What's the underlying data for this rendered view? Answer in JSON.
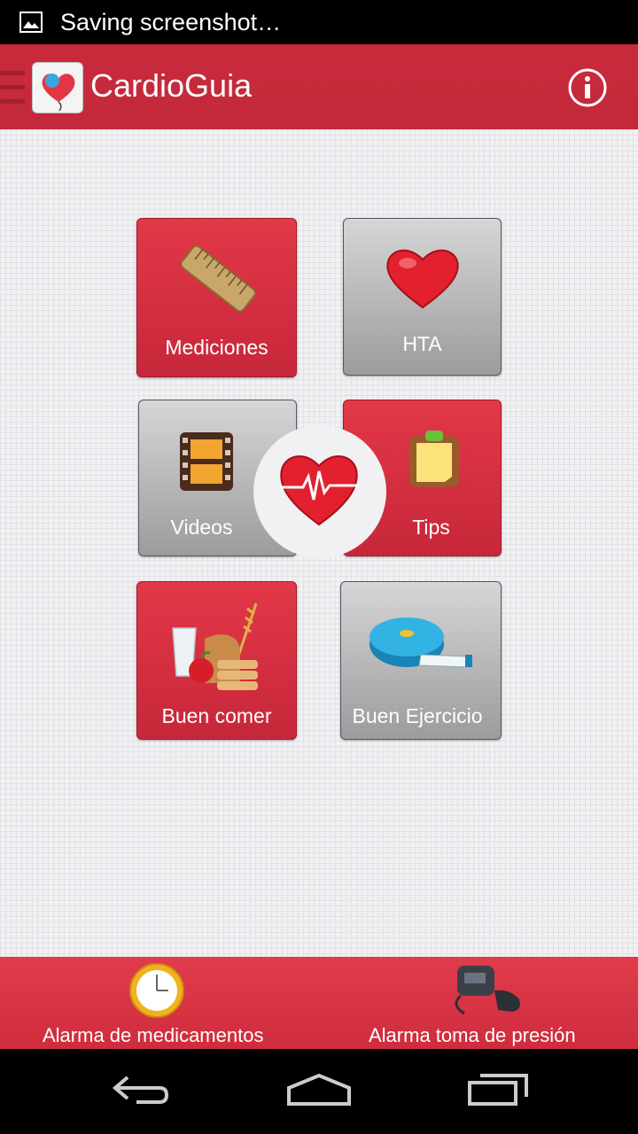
{
  "status_bar": {
    "text": "Saving screenshot…",
    "icon": "image-icon"
  },
  "action_bar": {
    "title": "CardioGuia",
    "menu_icon": "hamburger-icon",
    "info_icon": "info-icon"
  },
  "tiles": [
    {
      "label": "Mediciones",
      "icon": "ruler-icon"
    },
    {
      "label": "HTA",
      "icon": "heart-icon"
    },
    {
      "label": "Videos",
      "icon": "film-icon"
    },
    {
      "label": "Tips",
      "icon": "clipboard-icon"
    },
    {
      "label": "Buen comer",
      "icon": "food-icon"
    },
    {
      "label": "Buen Ejercicio",
      "icon": "tape-measure-icon"
    }
  ],
  "center_icon": "heartbeat-icon",
  "bottom_bar": {
    "medication_alarm": "Alarma de medicamentos",
    "pressure_alarm": "Alarma toma de presión"
  },
  "nav_bar": {
    "back": "back-icon",
    "home": "home-icon",
    "recents": "recents-icon"
  },
  "colors": {
    "brand_red": "#c92a3c",
    "tile_gray": "#b5b5b5",
    "background": "#f1f1f3"
  }
}
